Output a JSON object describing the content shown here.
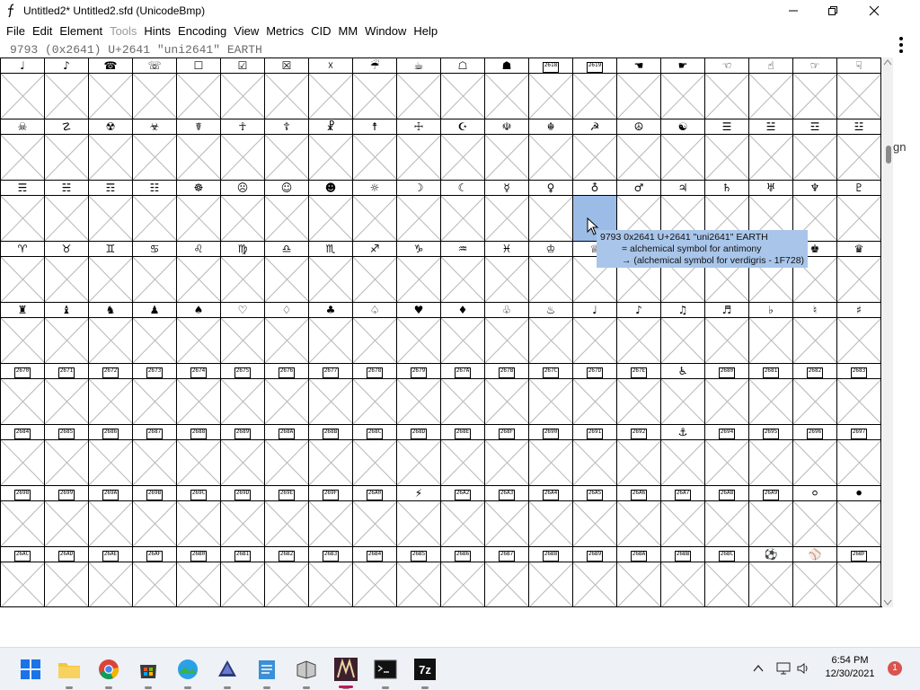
{
  "window": {
    "title": "Untitled2*  Untitled2.sfd (UnicodeBmp)",
    "minimize_icon": "minimize-icon",
    "maximize_icon": "restore-icon",
    "close_icon": "close-icon"
  },
  "menu": [
    "File",
    "Edit",
    "Element",
    "Tools",
    "Hints",
    "Encoding",
    "View",
    "Metrics",
    "CID",
    "MM",
    "Window",
    "Help"
  ],
  "menu_disabled": [
    "Tools"
  ],
  "info_line": "9793 (0x2641) U+2641 \"uni2641\" EARTH",
  "grid": {
    "rows": [
      {
        "labels": [
          "♩",
          "♪",
          "☎",
          "☏",
          "☐",
          "☑",
          "☒",
          "☓",
          "☔",
          "☕",
          "☖",
          "☗",
          "[2618]",
          "[2619]",
          "☚",
          "☛",
          "☜",
          "☝",
          "☞",
          "☟"
        ]
      },
      {
        "labels": [
          "☠",
          "☡",
          "☢",
          "☣",
          "☤",
          "☥",
          "☦",
          "☧",
          "☨",
          "☩",
          "☪",
          "☫",
          "☬",
          "☭",
          "☮",
          "☯",
          "☰",
          "☱",
          "☲",
          "☳"
        ]
      },
      {
        "labels": [
          "☴",
          "☵",
          "☶",
          "☷",
          "☸",
          "☹",
          "☺",
          "☻",
          "☼",
          "☽",
          "☾",
          "☿",
          "♀",
          "♁",
          "♂",
          "♃",
          "♄",
          "♅",
          "♆",
          "♇"
        ]
      },
      {
        "labels": [
          "♈",
          "♉",
          "♊",
          "♋",
          "♌",
          "♍",
          "♎",
          "♏",
          "♐",
          "♑",
          "♒",
          "♓",
          "♔",
          "♕",
          "♖",
          "♗",
          "♘",
          "♙",
          "♚",
          "♛"
        ]
      },
      {
        "labels": [
          "♜",
          "♝",
          "♞",
          "♟",
          "♠",
          "♡",
          "♢",
          "♣",
          "♤",
          "♥",
          "♦",
          "♧",
          "♨",
          "♩",
          "♪",
          "♫",
          "♬",
          "♭",
          "♮",
          "♯"
        ]
      },
      {
        "labels": [
          "[2670]",
          "[2671]",
          "[2672]",
          "[2673]",
          "[2674]",
          "[2675]",
          "[2676]",
          "[2677]",
          "[2678]",
          "[2679]",
          "[267A]",
          "[267B]",
          "[267C]",
          "[267D]",
          "[267E]",
          "♿",
          "[2680]",
          "[2681]",
          "[2682]",
          "[2683]"
        ]
      },
      {
        "labels": [
          "[2684]",
          "[2685]",
          "[2686]",
          "[2687]",
          "[2688]",
          "[2689]",
          "[268A]",
          "[268B]",
          "[268C]",
          "[268D]",
          "[268E]",
          "[268F]",
          "[2690]",
          "[2691]",
          "[2692]",
          "⚓",
          "[2694]",
          "[2695]",
          "[2696]",
          "[2697]"
        ]
      },
      {
        "labels": [
          "[2698]",
          "[2699]",
          "[269A]",
          "[269B]",
          "[269C]",
          "[269D]",
          "[269E]",
          "[269F]",
          "[26A0]",
          "⚡",
          "[26A2]",
          "[26A3]",
          "[26A4]",
          "[26A5]",
          "[26A6]",
          "[26A7]",
          "[26A8]",
          "[26A9]",
          "⚪",
          "⚫"
        ]
      },
      {
        "labels": [
          "[26AC]",
          "[26AD]",
          "[26AE]",
          "[26AF]",
          "[26B0]",
          "[26B1]",
          "[26B2]",
          "[26B3]",
          "[26B4]",
          "[26B5]",
          "[26B6]",
          "[26B7]",
          "[26B8]",
          "[26B9]",
          "[26BA]",
          "[26BB]",
          "[26BC]",
          "⚽",
          "⚾",
          "[26BF]"
        ]
      }
    ]
  },
  "tooltip": {
    "line1": "9793 0x2641 U+2641 \"uni2641\" EARTH",
    "line2": "= alchemical symbol for antimony",
    "line3": "→ (alchemical symbol for verdigris - 1F728)"
  },
  "background_window_text": "gn",
  "taskbar": {
    "icons": [
      "windows-start-icon",
      "file-explorer-icon",
      "chrome-icon",
      "store-icon",
      "photos-icon",
      "inkscape-icon",
      "notepad-icon",
      "app-icon",
      "fontforge-icon",
      "terminal-icon",
      "7zip-icon"
    ],
    "sevenzip_label": "7z",
    "time": "6:54 PM",
    "date": "12/30/2021",
    "notification_count": "1"
  },
  "colors": {
    "selection": "#9bbce6",
    "tooltip_bg": "#a9c6ea",
    "taskbar_bg": "#eef1f6",
    "notification_badge": "#d9534f"
  }
}
